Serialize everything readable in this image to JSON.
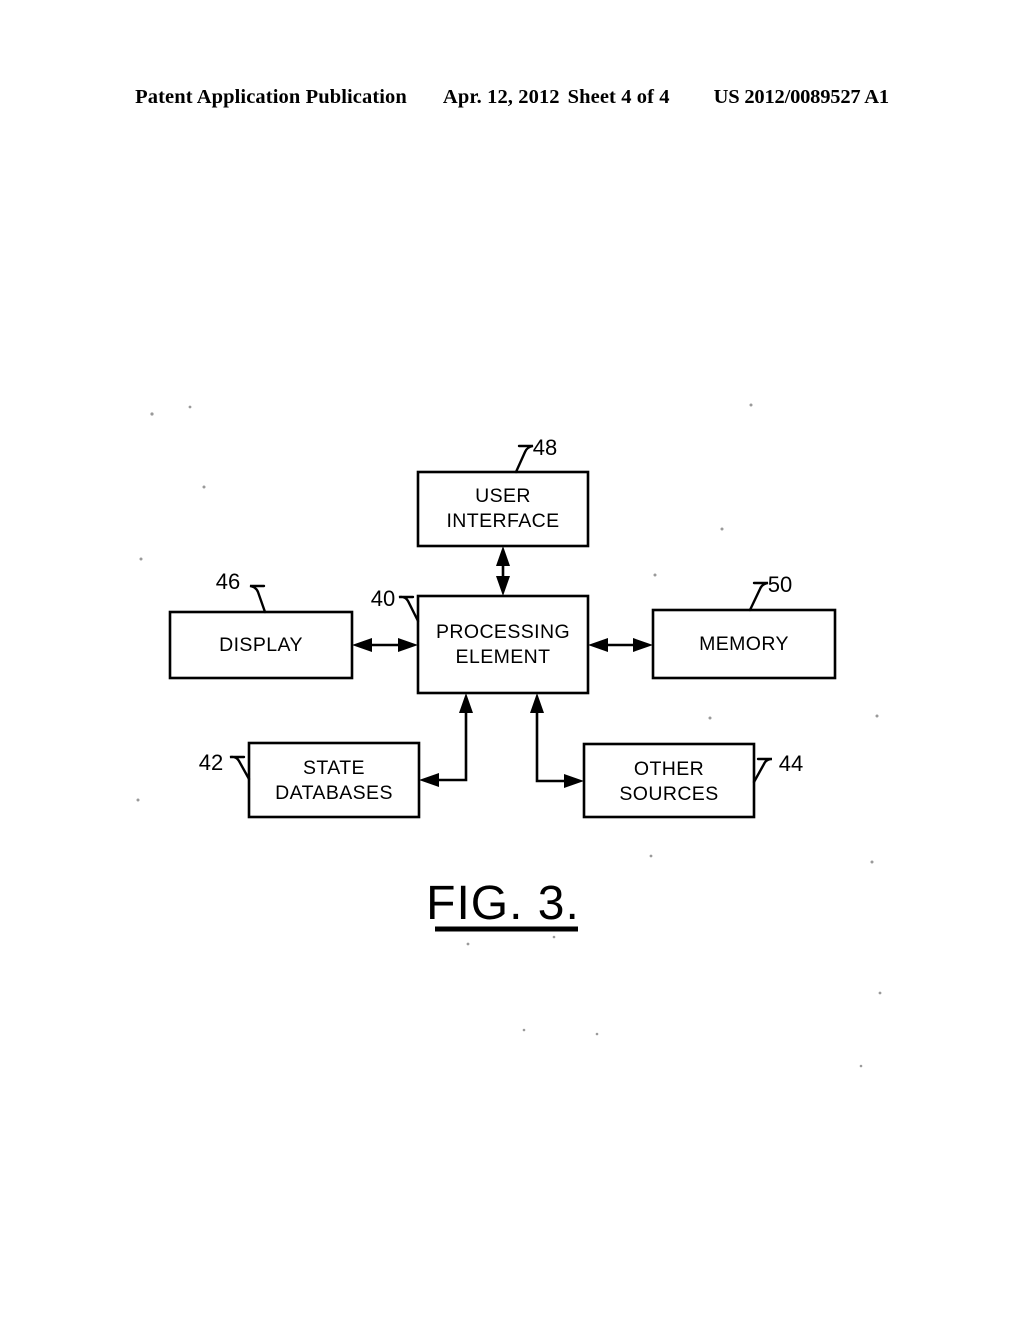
{
  "page": {
    "background_color": "#ffffff",
    "ink_color": "#000000"
  },
  "header": {
    "publication": "Patent Application Publication",
    "date": "Apr. 12, 2012",
    "sheet": "Sheet 4 of 4",
    "patent_number": "US 2012/0089527 A1"
  },
  "figure": {
    "caption": "FIG. 3.",
    "boxes": [
      {
        "id": "user-interface",
        "label_line1": "USER",
        "label_line2": "INTERFACE",
        "ref": "48"
      },
      {
        "id": "processing-element",
        "label_line1": "PROCESSING",
        "label_line2": "ELEMENT",
        "ref": "40"
      },
      {
        "id": "display",
        "label_line1": "DISPLAY",
        "label_line2": "",
        "ref": "46"
      },
      {
        "id": "memory",
        "label_line1": "MEMORY",
        "label_line2": "",
        "ref": "50"
      },
      {
        "id": "state-databases",
        "label_line1": "STATE",
        "label_line2": "DATABASES",
        "ref": "42"
      },
      {
        "id": "other-sources",
        "label_line1": "OTHER",
        "label_line2": "SOURCES",
        "ref": "44"
      }
    ],
    "connections": [
      {
        "from": "processing-element",
        "to": "user-interface",
        "type": "double-arrow"
      },
      {
        "from": "display",
        "to": "processing-element",
        "type": "double-arrow"
      },
      {
        "from": "processing-element",
        "to": "memory",
        "type": "double-arrow"
      },
      {
        "from": "state-databases",
        "to": "processing-element",
        "type": "double-arrow-elbow"
      },
      {
        "from": "other-sources",
        "to": "processing-element",
        "type": "double-arrow-elbow"
      }
    ]
  }
}
